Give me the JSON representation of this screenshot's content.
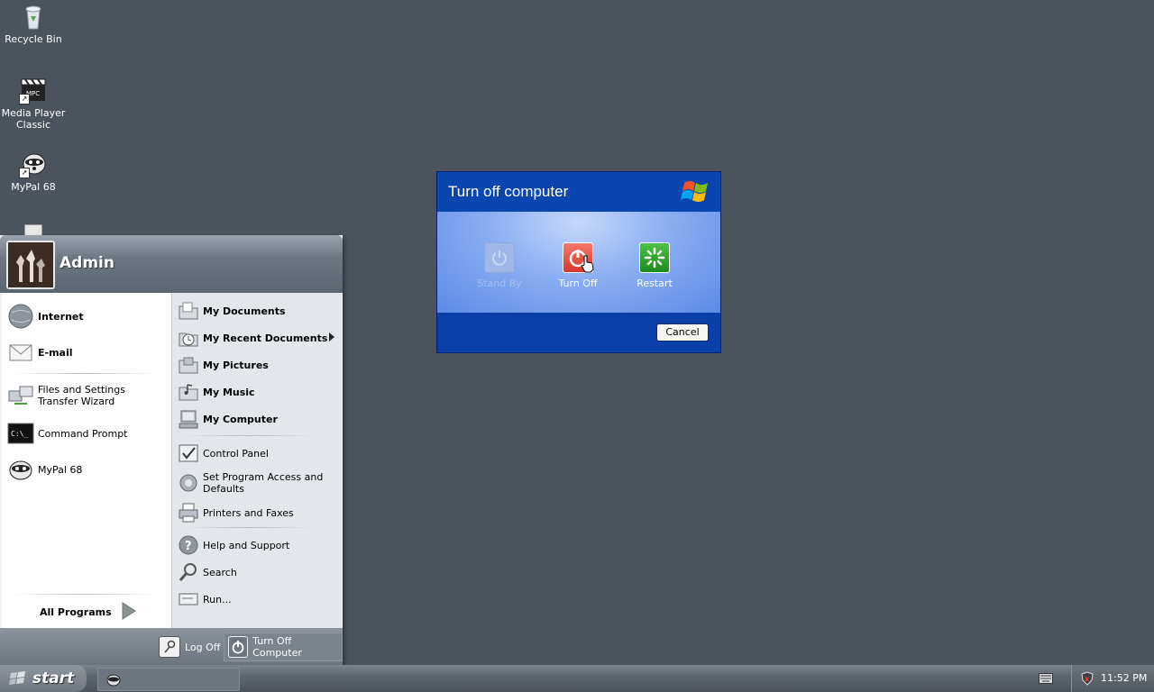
{
  "desktop": {
    "icons": [
      {
        "label": "Recycle Bin"
      },
      {
        "label": "Media Player Classic"
      },
      {
        "label": "MyPal 68"
      }
    ]
  },
  "start_menu": {
    "username": "Admin",
    "left_items": [
      {
        "label": "Internet"
      },
      {
        "label": "E-mail"
      },
      {
        "label": "Files and Settings Transfer Wizard"
      },
      {
        "label": "Command Prompt"
      },
      {
        "label": "MyPal 68"
      }
    ],
    "all_programs_label": "All Programs",
    "right_items": [
      {
        "label": "My Documents"
      },
      {
        "label": "My Recent Documents"
      },
      {
        "label": "My Pictures"
      },
      {
        "label": "My Music"
      },
      {
        "label": "My Computer"
      },
      {
        "label": "Control Panel"
      },
      {
        "label": "Set Program Access and Defaults"
      },
      {
        "label": "Printers and Faxes"
      },
      {
        "label": "Help and Support"
      },
      {
        "label": "Search"
      },
      {
        "label": "Run..."
      }
    ],
    "log_off_label": "Log Off",
    "turn_off_label": "Turn Off Computer"
  },
  "dialog": {
    "title": "Turn off computer",
    "buttons": [
      {
        "label": "Stand By",
        "enabled": false
      },
      {
        "label": "Turn Off",
        "enabled": true
      },
      {
        "label": "Restart",
        "enabled": true
      }
    ],
    "cancel_label": "Cancel"
  },
  "taskbar": {
    "start_label": "start",
    "clock": "11:52 PM"
  },
  "colors": {
    "desktop": "#4b535d",
    "dialog_blue": "#0a46b0",
    "turn_off_red": "#e8483b",
    "restart_green": "#2e9a2e"
  }
}
